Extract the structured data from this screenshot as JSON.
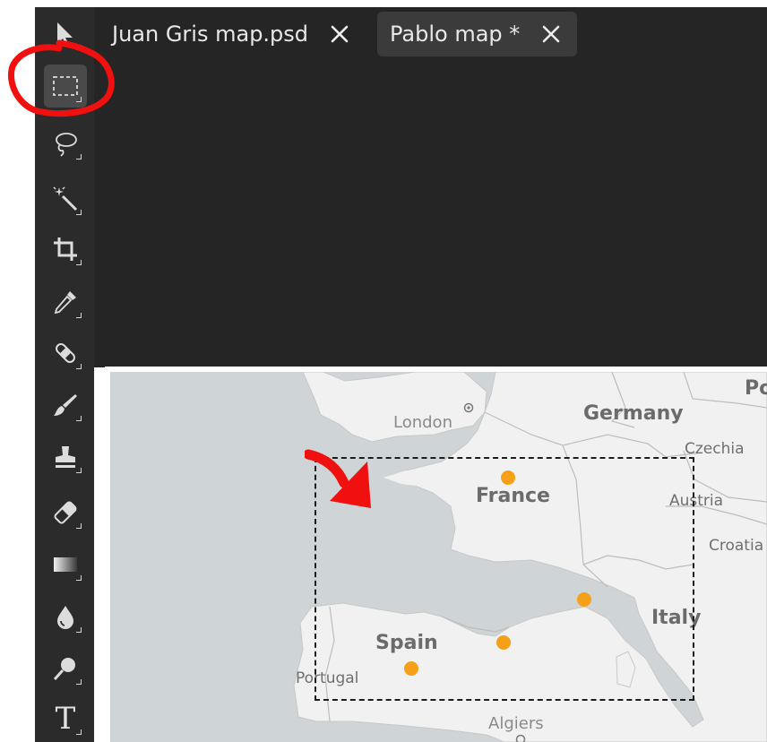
{
  "toolbar": {
    "tools": [
      {
        "name": "move-tool",
        "icon": "move-arrow-icon"
      },
      {
        "name": "rectangular-marquee-tool",
        "icon": "dashed-rectangle-icon",
        "selected": true
      },
      {
        "name": "lasso-tool",
        "icon": "lasso-icon"
      },
      {
        "name": "magic-wand-tool",
        "icon": "magic-wand-icon"
      },
      {
        "name": "crop-tool",
        "icon": "crop-icon"
      },
      {
        "name": "eyedropper-tool",
        "icon": "eyedropper-icon"
      },
      {
        "name": "healing-brush-tool",
        "icon": "bandage-icon"
      },
      {
        "name": "brush-tool",
        "icon": "brush-icon"
      },
      {
        "name": "clone-stamp-tool",
        "icon": "stamp-icon"
      },
      {
        "name": "eraser-tool",
        "icon": "eraser-icon"
      },
      {
        "name": "gradient-tool",
        "icon": "gradient-icon"
      },
      {
        "name": "blur-tool",
        "icon": "drop-icon"
      },
      {
        "name": "dodge-tool",
        "icon": "dodge-icon"
      },
      {
        "name": "type-tool",
        "icon": "text-icon",
        "glyph": "T"
      }
    ]
  },
  "tabs": [
    {
      "label": "Juan Gris map.psd",
      "active": false
    },
    {
      "label": "Pablo map *",
      "active": true
    }
  ],
  "map": {
    "countries": {
      "germany": "Germany",
      "france": "France",
      "spain": "Spain",
      "italy": "Italy",
      "czechia": "Czechia",
      "austria": "Austria",
      "croatia": "Croatia",
      "portugal": "Portugal",
      "poland_partial": "Po"
    },
    "cities": {
      "london": "London",
      "algiers": "Algiers"
    },
    "marker_color": "#f5a018"
  },
  "annotations": {
    "color": "#f01010"
  },
  "colors": {
    "toolbar_bg": "#2b2b2b",
    "workspace_bg": "#252525",
    "active_tab_bg": "#3b3b3b",
    "sea": "#cfd4d6",
    "land": "#f1f1f1"
  }
}
